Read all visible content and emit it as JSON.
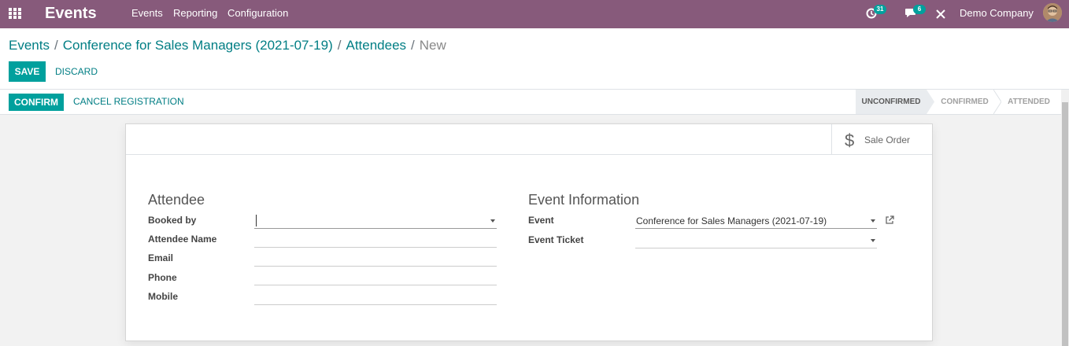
{
  "navbar": {
    "app_title": "Events",
    "menu": [
      "Events",
      "Reporting",
      "Configuration"
    ],
    "activity_count": "31",
    "messages_count": "6",
    "company": "Demo Company"
  },
  "breadcrumb": {
    "items": [
      "Events",
      "Conference for Sales Managers (2021-07-19)",
      "Attendees"
    ],
    "current": "New"
  },
  "actions": {
    "save": "SAVE",
    "discard": "DISCARD"
  },
  "statusbar": {
    "confirm": "CONFIRM",
    "cancel_registration": "CANCEL REGISTRATION",
    "stages": [
      "UNCONFIRMED",
      "CONFIRMED",
      "ATTENDED"
    ],
    "active_stage": "UNCONFIRMED"
  },
  "sheet": {
    "stat_button": "Sale Order",
    "attendee": {
      "title": "Attendee",
      "booked_by_label": "Booked by",
      "booked_by_value": "",
      "name_label": "Attendee Name",
      "email_label": "Email",
      "phone_label": "Phone",
      "mobile_label": "Mobile"
    },
    "event_info": {
      "title": "Event Information",
      "event_label": "Event",
      "event_value": "Conference for Sales Managers (2021-07-19)",
      "ticket_label": "Event Ticket",
      "ticket_value": ""
    }
  },
  "colors": {
    "navbar": "#875a7b",
    "primary": "#00a09d",
    "link": "#017e84"
  },
  "icons": [
    "apps-icon",
    "activity-icon",
    "chat-icon",
    "debug-icon",
    "dollar-icon",
    "dropdown-caret-icon",
    "external-link-icon"
  ]
}
